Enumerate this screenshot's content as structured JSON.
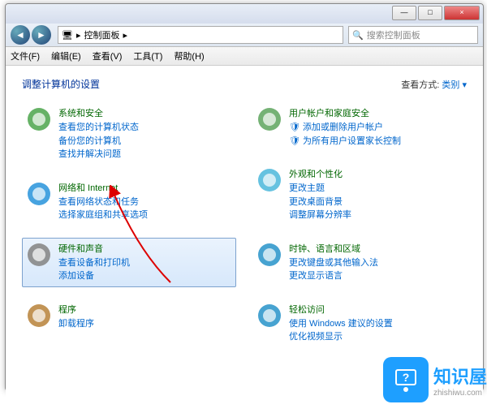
{
  "titlebar": {
    "min": "—",
    "max": "□",
    "close": "×"
  },
  "nav": {
    "back": "◄",
    "fwd": "►"
  },
  "breadcrumb": {
    "icon": "🖥",
    "text": "控制面板",
    "sep": "▸"
  },
  "search": {
    "placeholder": "搜索控制面板",
    "icon": "🔍"
  },
  "menu": {
    "file": "文件(F)",
    "edit": "编辑(E)",
    "view": "查看(V)",
    "tools": "工具(T)",
    "help": "帮助(H)"
  },
  "header": {
    "title": "调整计算机的设置",
    "view_label": "查看方式:",
    "view_value": "类别 ▾"
  },
  "left": [
    {
      "icon": "shield",
      "title": "系统和安全",
      "links": [
        "查看您的计算机状态",
        "备份您的计算机",
        "查找并解决问题"
      ]
    },
    {
      "icon": "network",
      "title": "网络和 Internet",
      "links": [
        "查看网络状态和任务",
        "选择家庭组和共享选项"
      ]
    },
    {
      "icon": "hardware",
      "title": "硬件和声音",
      "links": [
        "查看设备和打印机",
        "添加设备"
      ],
      "selected": true
    },
    {
      "icon": "programs",
      "title": "程序",
      "links": [
        "卸载程序"
      ]
    }
  ],
  "right": [
    {
      "icon": "users",
      "title": "用户帐户和家庭安全",
      "links": [
        "🛡 添加或删除用户帐户",
        "🛡 为所有用户设置家长控制"
      ]
    },
    {
      "icon": "appearance",
      "title": "外观和个性化",
      "links": [
        "更改主题",
        "更改桌面背景",
        "调整屏幕分辨率"
      ]
    },
    {
      "icon": "clock",
      "title": "时钟、语言和区域",
      "links": [
        "更改键盘或其他输入法",
        "更改显示语言"
      ]
    },
    {
      "icon": "access",
      "title": "轻松访问",
      "links": [
        "使用 Windows 建议的设置",
        "优化视频显示"
      ]
    }
  ],
  "badge": {
    "name": "知识屋",
    "url": "zhishiwu.com"
  }
}
